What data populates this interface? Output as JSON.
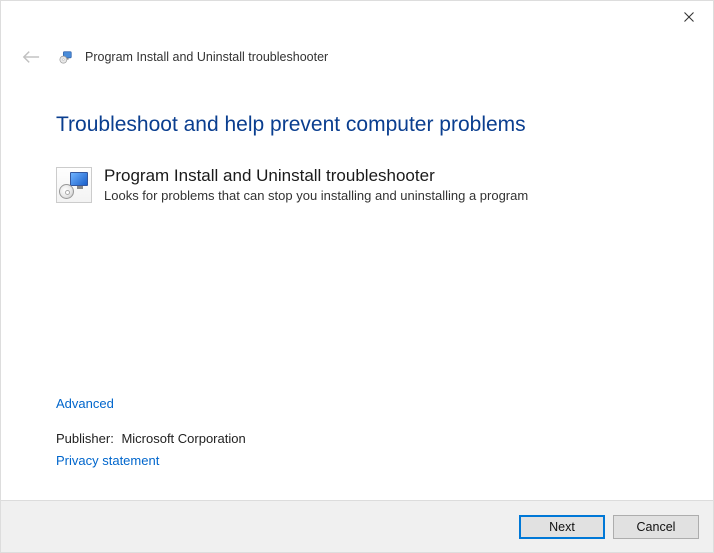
{
  "header": {
    "title": "Program Install and Uninstall troubleshooter"
  },
  "main": {
    "heading": "Troubleshoot and help prevent computer problems",
    "program_title": "Program Install and Uninstall troubleshooter",
    "program_desc": "Looks for problems that can stop you installing and uninstalling a program"
  },
  "links": {
    "advanced": "Advanced",
    "privacy": "Privacy statement"
  },
  "publisher": {
    "label": "Publisher:",
    "value": "Microsoft Corporation"
  },
  "footer": {
    "next": "Next",
    "cancel": "Cancel"
  }
}
